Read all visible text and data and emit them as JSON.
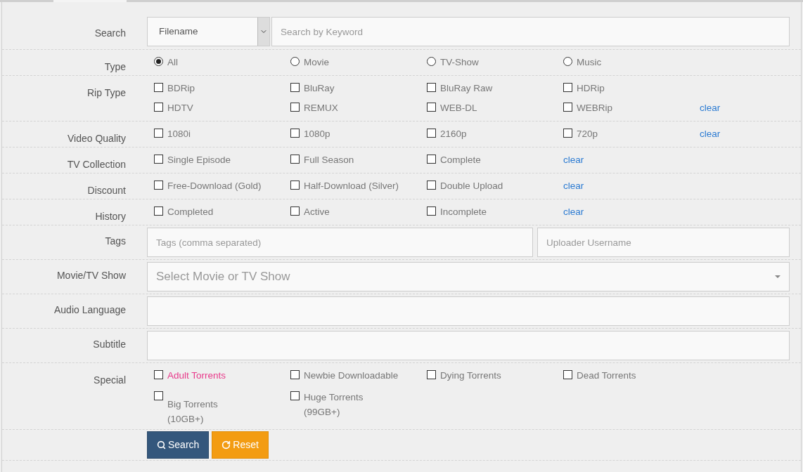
{
  "search": {
    "label": "Search",
    "field_select": "Filename",
    "placeholder": "Search by Keyword"
  },
  "groups": [
    {
      "label": "Type",
      "kind": "radio",
      "lines": [
        [
          {
            "text": "All",
            "selected": true
          },
          {
            "text": "Movie",
            "selected": false
          },
          {
            "text": "TV-Show",
            "selected": false
          },
          {
            "text": "Music",
            "selected": false
          }
        ]
      ]
    },
    {
      "label": "Rip Type",
      "kind": "checkbox",
      "clear": "clear",
      "lines": [
        [
          {
            "text": "BDRip",
            "checked": false
          },
          {
            "text": "BluRay",
            "checked": false
          },
          {
            "text": "BluRay Raw",
            "checked": false
          },
          {
            "text": "HDRip",
            "checked": false
          }
        ],
        [
          {
            "text": "HDTV",
            "checked": false
          },
          {
            "text": "REMUX",
            "checked": false
          },
          {
            "text": "WEB-DL",
            "checked": false
          },
          {
            "text": "WEBRip",
            "checked": false
          }
        ]
      ]
    },
    {
      "label": "Video Quality",
      "kind": "checkbox",
      "clear": "clear",
      "lines": [
        [
          {
            "text": "1080i",
            "checked": false
          },
          {
            "text": "1080p",
            "checked": false
          },
          {
            "text": "2160p",
            "checked": false
          },
          {
            "text": "720p",
            "checked": false
          }
        ]
      ]
    },
    {
      "label": "TV Collection",
      "kind": "checkbox",
      "clear": "clear",
      "lines": [
        [
          {
            "text": "Single Episode",
            "checked": false
          },
          {
            "text": "Full Season",
            "checked": false
          },
          {
            "text": "Complete",
            "checked": false
          }
        ]
      ]
    },
    {
      "label": "Discount",
      "kind": "checkbox",
      "clear": "clear",
      "lines": [
        [
          {
            "text": "Free-Download (Gold)",
            "checked": false
          },
          {
            "text": "Half-Download (Silver)",
            "checked": false
          },
          {
            "text": "Double Upload",
            "checked": false
          }
        ]
      ]
    },
    {
      "label": "History",
      "kind": "checkbox",
      "clear": "clear",
      "lines": [
        [
          {
            "text": "Completed",
            "checked": false
          },
          {
            "text": "Active",
            "checked": false
          },
          {
            "text": "Incomplete",
            "checked": false
          }
        ]
      ]
    }
  ],
  "tags": {
    "label": "Tags",
    "placeholder": "Tags (comma separated)",
    "uploader_placeholder": "Uploader Username"
  },
  "movie_tv_show": {
    "label": "Movie/TV Show",
    "placeholder": "Select Movie or TV Show"
  },
  "audio_language": {
    "label": "Audio Language"
  },
  "subtitle": {
    "label": "Subtitle"
  },
  "special": {
    "label": "Special",
    "lines": [
      [
        {
          "text": "Adult Torrents",
          "checked": false,
          "color": "#e8398a"
        },
        {
          "text": "Newbie Downloadable",
          "checked": false,
          "color": "#777777"
        },
        {
          "text": "Dying Torrents",
          "checked": false,
          "color": "#777777"
        },
        {
          "text": "Dead Torrents",
          "checked": false,
          "color": "#777777"
        }
      ],
      [
        {
          "text": "Big Torrents (10GB+)",
          "checked": false,
          "color": "#777777"
        },
        {
          "text": "Huge Torrents (99GB+)",
          "checked": false,
          "color": "#777777"
        }
      ]
    ]
  },
  "buttons": [
    {
      "kind": "search",
      "label": "Search"
    },
    {
      "kind": "reset",
      "label": "Reset"
    }
  ]
}
